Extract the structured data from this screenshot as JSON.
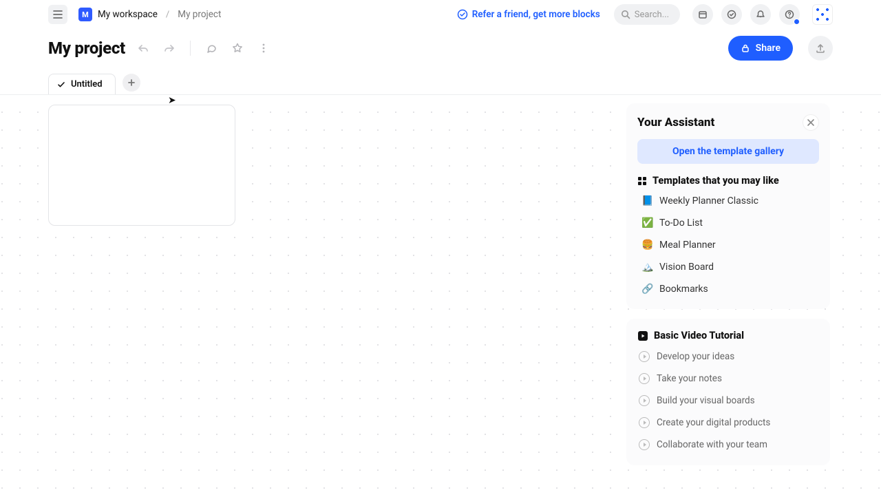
{
  "breadcrumb": {
    "workspace_badge": "M",
    "workspace": "My workspace",
    "project": "My project"
  },
  "header": {
    "refer_text": "Refer a friend, get more blocks",
    "search_placeholder": "Search..."
  },
  "title": {
    "page_title": "My project",
    "share_label": "Share"
  },
  "tabs": [
    {
      "label": "Untitled"
    }
  ],
  "assistant": {
    "title": "Your Assistant",
    "open_gallery": "Open the template gallery",
    "templates_heading": "Templates that you may like",
    "templates": [
      {
        "emoji": "📘",
        "label": "Weekly Planner Classic"
      },
      {
        "emoji": "✅",
        "label": "To-Do List"
      },
      {
        "emoji": "🍔",
        "label": "Meal Planner"
      },
      {
        "emoji": "🏔️",
        "label": "Vision Board"
      },
      {
        "emoji": "🔗",
        "label": "Bookmarks"
      }
    ],
    "video_heading": "Basic Video Tutorial",
    "videos": [
      "Develop your ideas",
      "Take your notes",
      "Build your visual boards",
      "Create your digital products",
      "Collaborate with your team"
    ]
  }
}
